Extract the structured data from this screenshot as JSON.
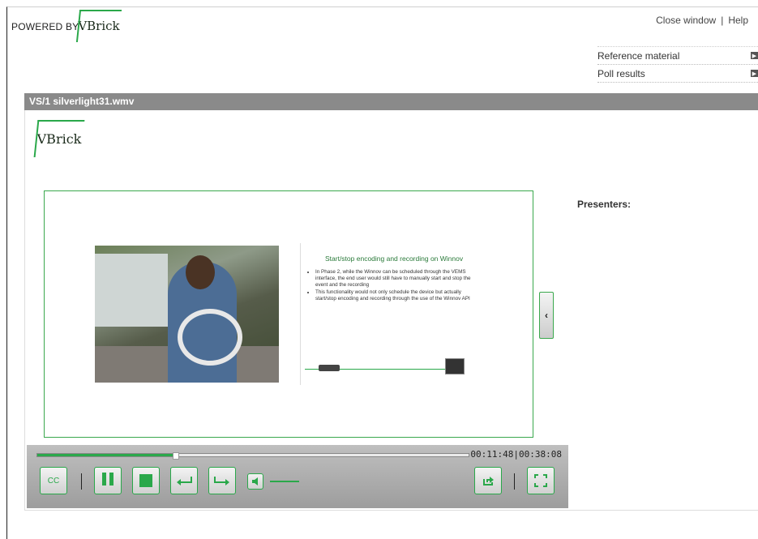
{
  "header": {
    "powered_by": "POWERED BY",
    "logo_text": "VBrick",
    "links": {
      "close": "Close window",
      "sep": "|",
      "help": "Help"
    }
  },
  "side_menu": [
    {
      "label": "Reference material",
      "icon": "arrow-right-icon"
    },
    {
      "label": "Poll results",
      "icon": "arrow-right-icon"
    }
  ],
  "player": {
    "title": "VS/1 silverlight31.wmv",
    "inner_logo": "VBrick",
    "presenters_label": "Presenters:",
    "slide": {
      "title": "Start/stop encoding and recording on Winnov",
      "bullets": [
        "In Phase 2, while the Winnov can be scheduled through the VEMS interface, the end user would still have to manually start and stop the event and the recording",
        "This functionality would not only schedule the device but actually start/stop encoding and recording through the use of the Winnov API"
      ]
    },
    "collapse_icon": "chevron-left-icon",
    "controls": {
      "time": "00:11:48|00:38:08",
      "progress": 0.32,
      "cc_label": "CC",
      "divider": "|"
    }
  },
  "colors": {
    "accent": "#2aa84a",
    "titlebar": "#8a8a8a"
  }
}
